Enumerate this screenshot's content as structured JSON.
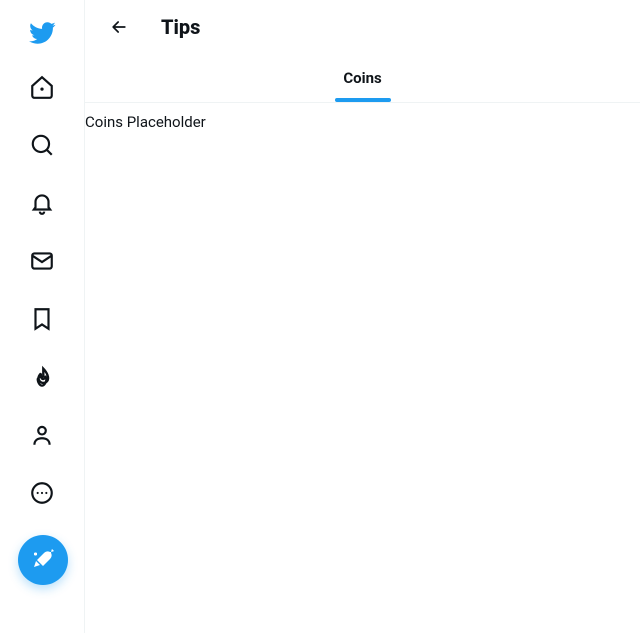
{
  "brand": {
    "color": "#1d9bf0"
  },
  "header": {
    "title": "Tips"
  },
  "tabs": [
    {
      "label": "Coins",
      "active": true
    }
  ],
  "content": {
    "placeholder_text": "Coins Placeholder"
  },
  "sidebar": {
    "items": [
      {
        "name": "home"
      },
      {
        "name": "search"
      },
      {
        "name": "notifications"
      },
      {
        "name": "messages"
      },
      {
        "name": "bookmarks"
      },
      {
        "name": "trends"
      },
      {
        "name": "profile"
      },
      {
        "name": "more"
      }
    ]
  }
}
